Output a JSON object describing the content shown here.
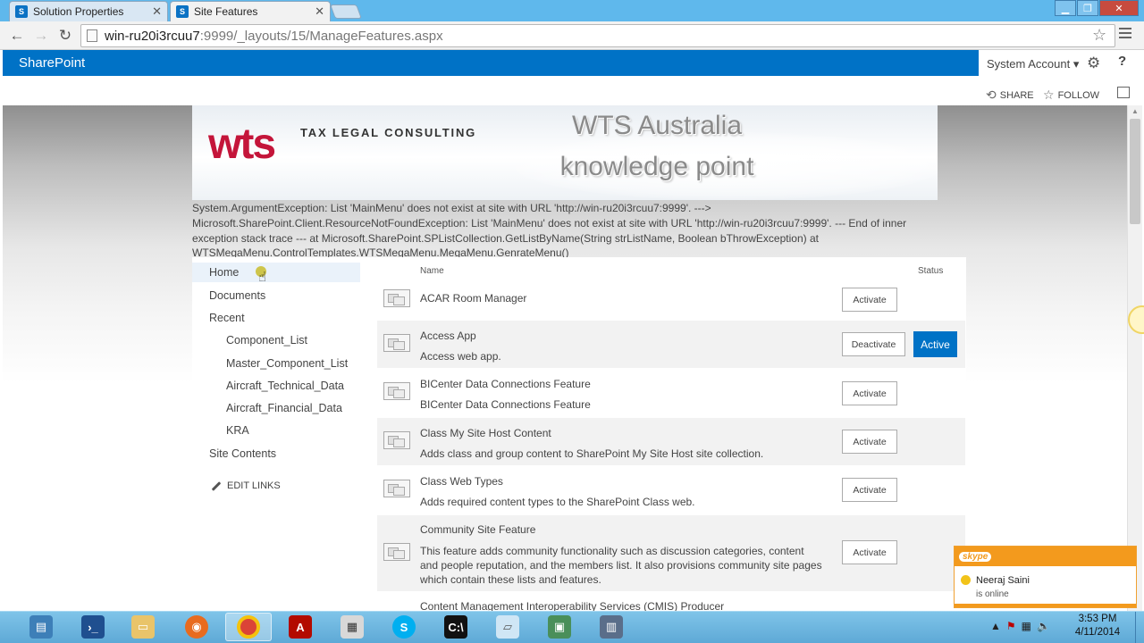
{
  "browser": {
    "tabs": [
      {
        "label": "Solution Properties",
        "active": false
      },
      {
        "label": "Site Features",
        "active": true
      }
    ],
    "url_host": "win-ru20i3rcuu7",
    "url_rest": ":9999/_layouts/15/ManageFeatures.aspx",
    "window_controls": {
      "minimize": "▁",
      "maximize": "❐",
      "close": "✕"
    }
  },
  "suitebar": {
    "brand": "SharePoint",
    "account": "System Account ▾",
    "settings_icon": "gear-icon",
    "help": "?"
  },
  "page_actions": {
    "share": "SHARE",
    "follow": "FOLLOW"
  },
  "banner": {
    "logo": "wts",
    "tagline": "TAX LEGAL CONSULTING",
    "title_line1": "WTS Australia",
    "title_line2": "knowledge point"
  },
  "error_message": "System.ArgumentException: List 'MainMenu' does not exist at site with URL 'http://win-ru20i3rcuu7:9999'. ---> Microsoft.SharePoint.Client.ResourceNotFoundException: List 'MainMenu' does not exist at site with URL 'http://win-ru20i3rcuu7:9999'. --- End of inner exception stack trace --- at Microsoft.SharePoint.SPListCollection.GetListByName(String strListName, Boolean bThrowException) at WTSMegaMenu.ControlTemplates.WTSMegaMenu.MegaMenu.GenrateMenu()",
  "quick_launch": {
    "home": "Home",
    "documents": "Documents",
    "recent": "Recent",
    "recent_items": [
      "Component_List",
      "Master_Component_List",
      "Aircraft_Technical_Data",
      "Aircraft_Financial_Data",
      "KRA"
    ],
    "site_contents": "Site Contents",
    "edit_links": "EDIT LINKS"
  },
  "features_table": {
    "header_name": "Name",
    "header_status": "Status",
    "activate_label": "Activate",
    "deactivate_label": "Deactivate",
    "active_label": "Active",
    "rows": [
      {
        "title": "ACAR Room Manager",
        "description": "",
        "active": false
      },
      {
        "title": "Access App",
        "description": "Access web app.",
        "active": true
      },
      {
        "title": "BICenter Data Connections Feature",
        "description": "BICenter Data Connections Feature",
        "active": false
      },
      {
        "title": "Class My Site Host Content",
        "description": "Adds class and group content to SharePoint My Site Host site collection.",
        "active": false
      },
      {
        "title": "Class Web Types",
        "description": "Adds required content types to the SharePoint Class web.",
        "active": false
      },
      {
        "title": "Community Site Feature",
        "description": "This feature adds community functionality such as discussion categories, content and people reputation, and the members list. It also provisions community site pages which contain these lists and features.",
        "active": false
      },
      {
        "title": "Content Management Interoperability Services (CMIS) Producer",
        "description": "",
        "active": false
      }
    ]
  },
  "skype_toast": {
    "brand": "skype",
    "contact": "Neeraj Saini",
    "status": "is online"
  },
  "taskbar": {
    "apps": [
      "server-manager",
      "powershell",
      "file-explorer",
      "firefox",
      "chrome",
      "adobe-reader",
      "sql-tool",
      "skype",
      "command-prompt",
      "notepad",
      "remote-desktop",
      "video-app"
    ],
    "clock_time": "3:53 PM",
    "clock_date": "4/11/2014"
  },
  "colors": {
    "suitebar": "#0072c6",
    "tabstrip": "#5fb8ec",
    "wts_red": "#c4153a",
    "skype_orange": "#f39a1d"
  }
}
